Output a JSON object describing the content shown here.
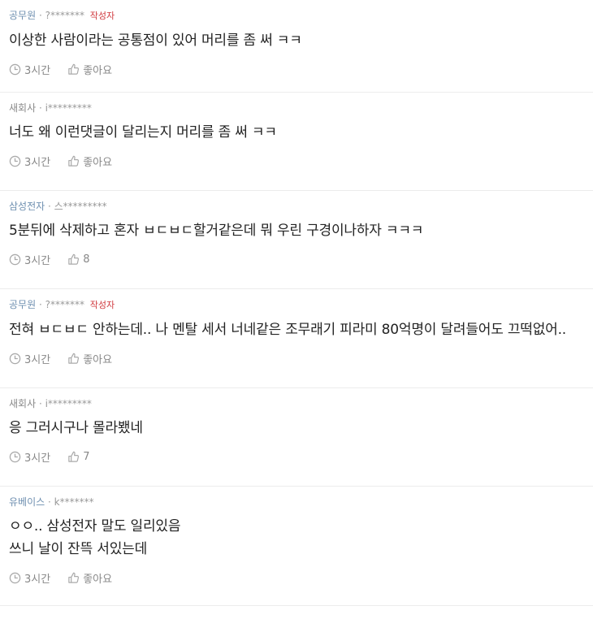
{
  "comments": [
    {
      "company": "공무원",
      "user": "?*******",
      "badge": "작성자",
      "lines": [
        "이상한 사람이라는 공통점이 있어 머리를 좀 써 ㅋㅋ"
      ],
      "time": "3시간",
      "like": "좋아요"
    },
    {
      "company": "새회사",
      "user": "i*********",
      "badge": "",
      "lines": [
        "너도 왜 이런댓글이 달리는지 머리를 좀 써 ㅋㅋ"
      ],
      "time": "3시간",
      "like": "좋아요"
    },
    {
      "company": "삼성전자",
      "user": "스*********",
      "badge": "",
      "lines": [
        "5분뒤에 삭제하고 혼자 ㅂㄷㅂㄷ할거같은데 뭐 우린 구경이나하자 ㅋㅋㅋ"
      ],
      "time": "3시간",
      "like": "8"
    },
    {
      "company": "공무원",
      "user": "?*******",
      "badge": "작성자",
      "lines": [
        "전혀 ㅂㄷㅂㄷ 안하는데.. 나 멘탈 세서 너네같은 조무래기 피라미 80억명이 달려들어도 끄떡없어.."
      ],
      "time": "3시간",
      "like": "좋아요"
    },
    {
      "company": "새회사",
      "user": "i*********",
      "badge": "",
      "lines": [
        "응 그러시구나 몰라뵀네"
      ],
      "time": "3시간",
      "like": "7"
    },
    {
      "company": "유베이스",
      "user": "k*******",
      "badge": "",
      "lines": [
        "ㅇㅇ.. 삼성전자 말도 일리있음",
        "쓰니 날이 잔뜩 서있는데"
      ],
      "time": "3시간",
      "like": "좋아요"
    }
  ],
  "colors": {
    "company": "#6e8fb0",
    "badge": "#d0393e",
    "meta": "#999999"
  },
  "icons": {
    "time": "clock-icon",
    "like": "thumbs-up-icon"
  }
}
